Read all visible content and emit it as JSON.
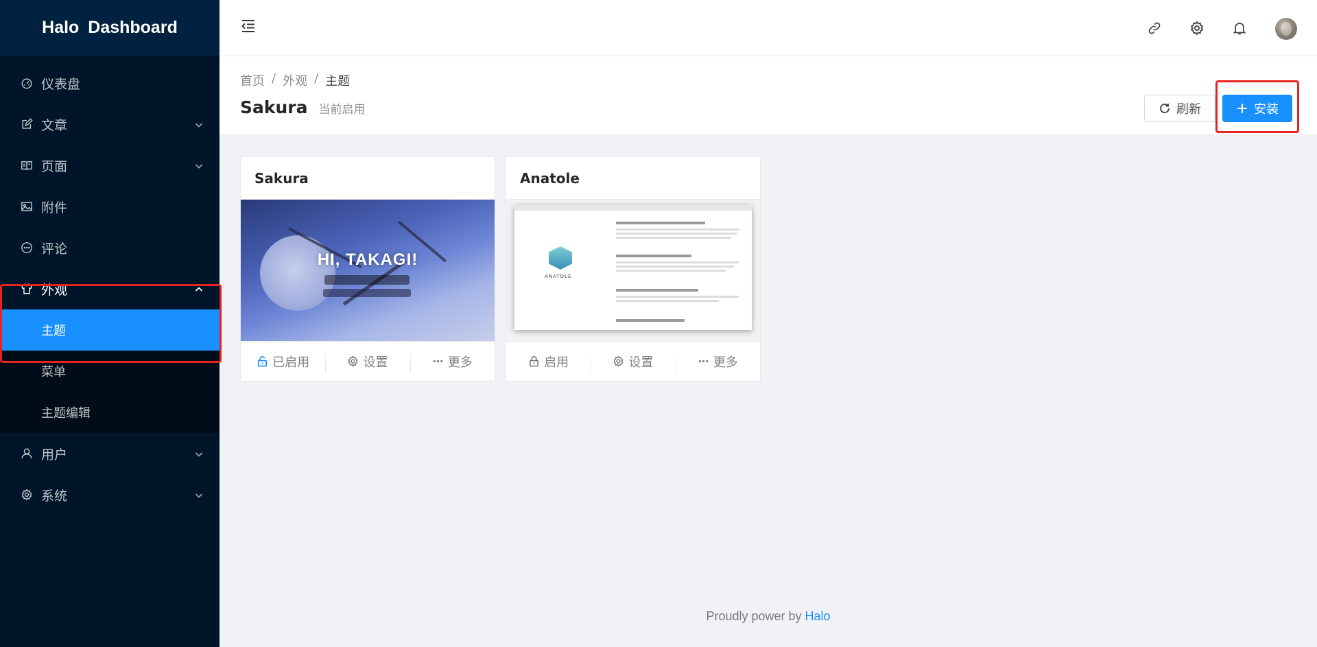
{
  "sidebar": {
    "logo": "Halo Dashboard",
    "items": [
      {
        "label": "仪表盘",
        "icon": "dashboard-icon"
      },
      {
        "label": "文章",
        "icon": "edit-icon"
      },
      {
        "label": "页面",
        "icon": "book-icon"
      },
      {
        "label": "附件",
        "icon": "picture-icon"
      },
      {
        "label": "评论",
        "icon": "message-icon"
      },
      {
        "label": "外观",
        "icon": "skin-icon"
      },
      {
        "label": "用户",
        "icon": "user-icon"
      },
      {
        "label": "系统",
        "icon": "setting-icon"
      }
    ],
    "appearance_sub": [
      {
        "label": "主题"
      },
      {
        "label": "菜单"
      },
      {
        "label": "主题编辑"
      }
    ]
  },
  "breadcrumb": [
    "首页",
    "/",
    "外观",
    "/",
    "主题"
  ],
  "page": {
    "title": "Sakura",
    "subtitle": "当前启用",
    "refresh_label": "刷新",
    "install_label": "安装"
  },
  "themes": [
    {
      "name": "Sakura",
      "cover_text": "HI, TAKAGI!",
      "actions": [
        "已启用",
        "设置",
        "更多"
      ]
    },
    {
      "name": "Anatole",
      "cover_text": "ANATOLE",
      "actions": [
        "启用",
        "设置",
        "更多"
      ]
    }
  ],
  "footer": {
    "text": "Proudly power by",
    "link": "Halo"
  },
  "colors": {
    "sidebar_bg": "#001529",
    "accent": "#1890ff",
    "highlight_box": "#e8221c"
  }
}
